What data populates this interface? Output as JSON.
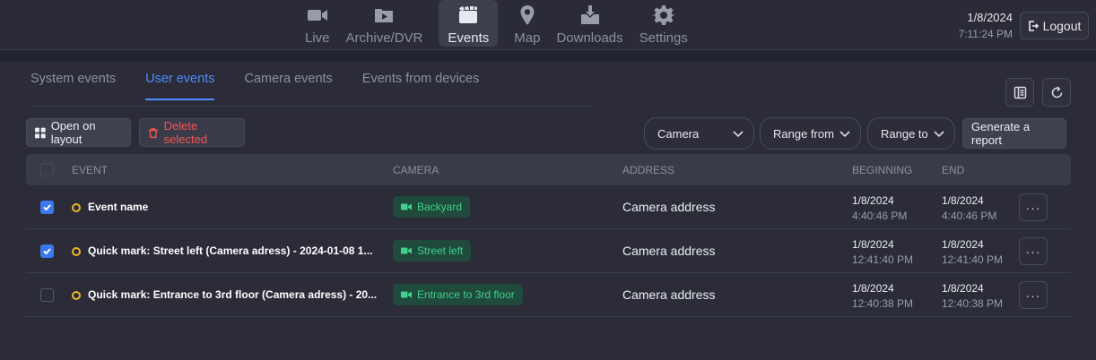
{
  "nav": {
    "items": [
      {
        "label": "Live",
        "icon": "video-camera-icon"
      },
      {
        "label": "Archive/DVR",
        "icon": "archive-folder-icon"
      },
      {
        "label": "Events",
        "icon": "clapperboard-icon",
        "active": true
      },
      {
        "label": "Map",
        "icon": "map-pin-icon"
      },
      {
        "label": "Downloads",
        "icon": "download-box-icon"
      },
      {
        "label": "Settings",
        "icon": "gear-icon"
      }
    ]
  },
  "header": {
    "date": "1/8/2024",
    "time": "7:11:24 PM",
    "logout_label": "Logout"
  },
  "tabs": [
    {
      "label": "System events"
    },
    {
      "label": "User events",
      "active": true
    },
    {
      "label": "Camera events"
    },
    {
      "label": "Events from devices"
    }
  ],
  "toolbar": {
    "open_on_layout": "Open on layout",
    "delete_selected": "Delete selected",
    "camera_select": "Camera",
    "range_from": "Range from",
    "range_to": "Range to",
    "generate_report": "Generate a report"
  },
  "table": {
    "columns": {
      "event": "EVENT",
      "camera": "CAMERA",
      "address": "ADDRESS",
      "beginning": "BEGINNING",
      "end": "END"
    },
    "rows": [
      {
        "checked": true,
        "event": "Event name",
        "camera": "Backyard",
        "address": "Camera address",
        "begin_date": "1/8/2024",
        "begin_time": "4:40:46 PM",
        "end_date": "1/8/2024",
        "end_time": "4:40:46 PM",
        "more": "···"
      },
      {
        "checked": true,
        "event": "Quick mark: Street left (Camera adress) - 2024-01-08 1...",
        "camera": "Street left",
        "address": "Camera address",
        "begin_date": "1/8/2024",
        "begin_time": "12:41:40 PM",
        "end_date": "1/8/2024",
        "end_time": "12:41:40 PM",
        "more": "···"
      },
      {
        "checked": false,
        "event": "Quick mark: Entrance to 3rd floor (Camera adress) - 20...",
        "camera": "Entrance to 3rd floor",
        "address": "Camera address",
        "begin_date": "1/8/2024",
        "begin_time": "12:40:38 PM",
        "end_date": "1/8/2024",
        "end_time": "12:40:38 PM",
        "more": "···"
      }
    ]
  },
  "colors": {
    "accent": "#4f8bff",
    "danger": "#f05656",
    "camera_badge_text": "#3ed28c",
    "event_dot": "#f0b429"
  }
}
